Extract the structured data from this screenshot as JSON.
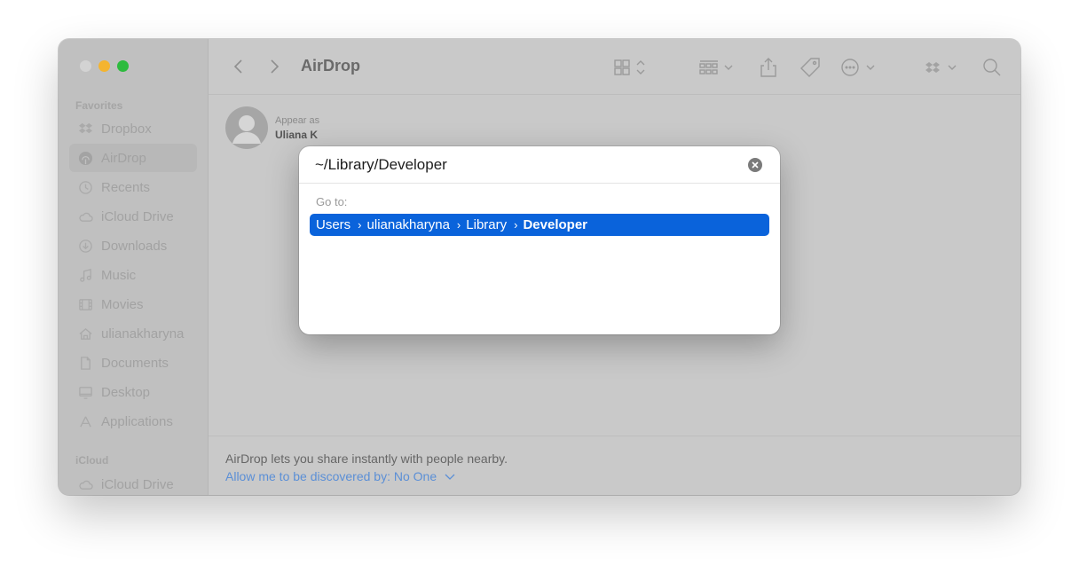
{
  "window": {
    "title": "AirDrop"
  },
  "sidebar": {
    "favorites_label": "Favorites",
    "icloud_label": "iCloud",
    "items": [
      {
        "label": "Dropbox",
        "icon": "dropbox-icon"
      },
      {
        "label": "AirDrop",
        "icon": "airdrop-icon",
        "selected": true
      },
      {
        "label": "Recents",
        "icon": "clock-icon"
      },
      {
        "label": "iCloud Drive",
        "icon": "cloud-icon"
      },
      {
        "label": "Downloads",
        "icon": "download-icon"
      },
      {
        "label": "Music",
        "icon": "music-note-icon"
      },
      {
        "label": "Movies",
        "icon": "film-icon"
      },
      {
        "label": "ulianakharyna",
        "icon": "home-icon"
      },
      {
        "label": "Documents",
        "icon": "document-icon"
      },
      {
        "label": "Desktop",
        "icon": "desktop-icon"
      },
      {
        "label": "Applications",
        "icon": "applications-icon"
      }
    ],
    "icloud_items": [
      {
        "label": "iCloud Drive",
        "icon": "cloud-icon"
      }
    ]
  },
  "airdrop": {
    "appear_as_label": "Appear as",
    "user_name": "Uliana K",
    "footer_text": "AirDrop lets you share instantly with people nearby.",
    "discover_link": "Allow me to be discovered by: No One"
  },
  "goto_dialog": {
    "path_value": "~/Library/Developer",
    "goto_label": "Go to:",
    "result_crumbs": [
      "Users",
      "ulianakharyna",
      "Library",
      "Developer"
    ]
  },
  "colors": {
    "selection": "#0a63db",
    "link": "#5b8fd6",
    "traffic_yellow": "#f4b42f",
    "traffic_green": "#2dbb3e"
  }
}
